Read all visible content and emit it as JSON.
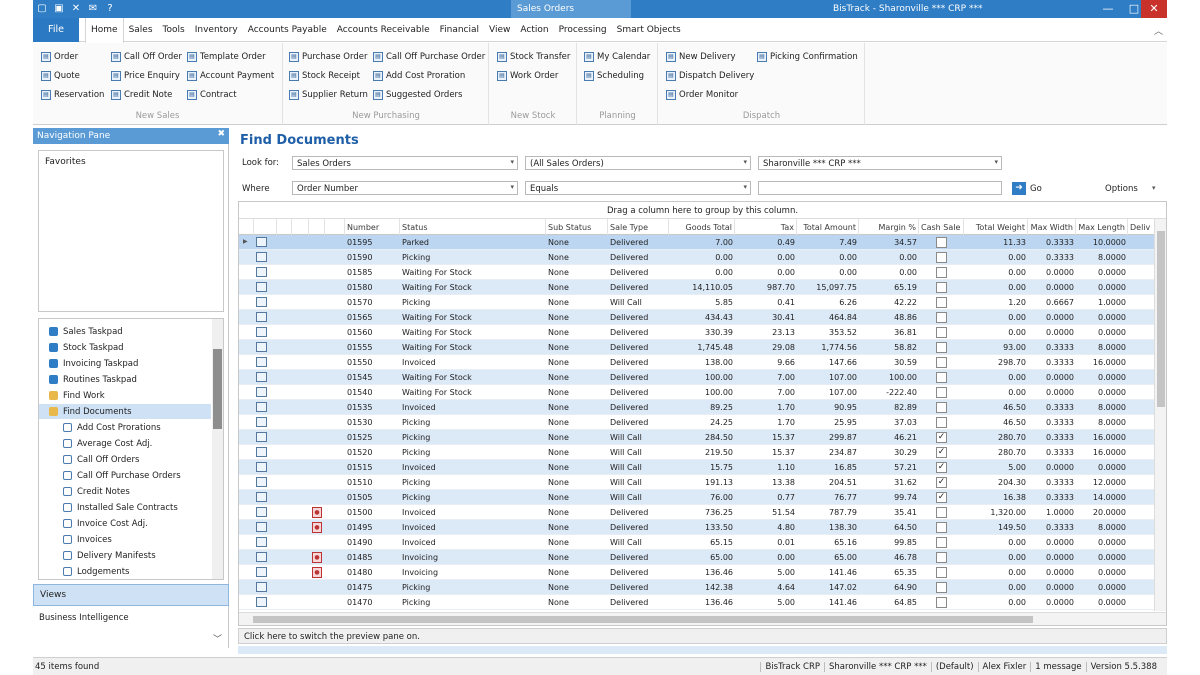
{
  "titlebar": {
    "context_tab": "Sales Orders",
    "app_title": "BisTrack - Sharonville *** CRP ***",
    "min": "—",
    "max": "□",
    "close": "✕"
  },
  "menu": {
    "file": "File",
    "tabs": [
      "Home",
      "Sales",
      "Tools",
      "Inventory",
      "Accounts Payable",
      "Accounts Receivable",
      "Financial",
      "View",
      "Action",
      "Processing",
      "Smart Objects"
    ]
  },
  "ribbon": {
    "new_sales": {
      "label": "New Sales",
      "buttons": [
        "Order",
        "Call Off Order",
        "Template Order",
        "Quote",
        "Price Enquiry",
        "Account Payment",
        "Reservation",
        "Credit Note",
        "Contract"
      ]
    },
    "new_purchasing": {
      "label": "New Purchasing",
      "buttons": [
        "Purchase Order",
        "Call Off Purchase Order",
        "Stock Receipt",
        "Add Cost Proration",
        "Supplier Return",
        "Suggested Orders"
      ]
    },
    "new_stock": {
      "label": "New Stock",
      "buttons": [
        "Stock Transfer",
        "Work Order"
      ]
    },
    "planning": {
      "label": "Planning",
      "buttons": [
        "My Calendar",
        "Scheduling"
      ]
    },
    "dispatch": {
      "label": "Dispatch",
      "buttons": [
        "New Delivery",
        "Picking Confirmation",
        "Dispatch Delivery",
        "Order Monitor"
      ]
    }
  },
  "nav": {
    "header": "Navigation Pane",
    "pin": "✖",
    "favorites": "Favorites",
    "tree": [
      "Sales Taskpad",
      "Stock Taskpad",
      "Invoicing Taskpad",
      "Routines Taskpad",
      "Find Work",
      "Find Documents",
      "Add Cost Prorations",
      "Average Cost Adj.",
      "Call Off Orders",
      "Call Off Purchase Orders",
      "Credit Notes",
      "Installed Sale Contracts",
      "Invoice Cost Adj.",
      "Invoices",
      "Delivery Manifests",
      "Lodgements"
    ],
    "views": "Views",
    "business_intelligence": "Business Intelligence"
  },
  "find": {
    "title": "Find Documents",
    "look_for_label": "Look for:",
    "look_for_value": "Sales Orders",
    "scope_value": "(All Sales Orders)",
    "branch_value": "Sharonville *** CRP ***",
    "where_label": "Where",
    "where_field": "Order Number",
    "operator": "Equals",
    "search_value": "",
    "go": "Go",
    "options": "Options"
  },
  "grid": {
    "group_hint": "Drag a column here to group by this column.",
    "columns": [
      "Number",
      "Status",
      "Sub Status",
      "Sale Type",
      "Goods Total",
      "Tax",
      "Total Amount",
      "Margin %",
      "Cash Sale",
      "Total Weight",
      "Max Width",
      "Max Length",
      "Deliv"
    ],
    "rows": [
      {
        "number": "01595",
        "status": "Parked",
        "sub": "None",
        "type": "Delivered",
        "goods": "7.00",
        "tax": "0.49",
        "total": "7.49",
        "margin": "34.57",
        "cash": false,
        "weight": "11.33",
        "width": "0.3333",
        "length": "10.0000",
        "flag": false
      },
      {
        "number": "01590",
        "status": "Picking",
        "sub": "None",
        "type": "Delivered",
        "goods": "0.00",
        "tax": "0.00",
        "total": "0.00",
        "margin": "0.00",
        "cash": false,
        "weight": "0.00",
        "width": "0.3333",
        "length": "8.0000",
        "flag": false
      },
      {
        "number": "01585",
        "status": "Waiting For Stock",
        "sub": "None",
        "type": "Delivered",
        "goods": "0.00",
        "tax": "0.00",
        "total": "0.00",
        "margin": "0.00",
        "cash": false,
        "weight": "0.00",
        "width": "0.0000",
        "length": "0.0000",
        "flag": false
      },
      {
        "number": "01580",
        "status": "Waiting For Stock",
        "sub": "None",
        "type": "Delivered",
        "goods": "14,110.05",
        "tax": "987.70",
        "total": "15,097.75",
        "margin": "65.19",
        "cash": false,
        "weight": "0.00",
        "width": "0.0000",
        "length": "0.0000",
        "flag": false
      },
      {
        "number": "01570",
        "status": "Picking",
        "sub": "None",
        "type": "Will Call",
        "goods": "5.85",
        "tax": "0.41",
        "total": "6.26",
        "margin": "42.22",
        "cash": false,
        "weight": "1.20",
        "width": "0.6667",
        "length": "1.0000",
        "flag": false
      },
      {
        "number": "01565",
        "status": "Waiting For Stock",
        "sub": "None",
        "type": "Delivered",
        "goods": "434.43",
        "tax": "30.41",
        "total": "464.84",
        "margin": "48.86",
        "cash": false,
        "weight": "0.00",
        "width": "0.0000",
        "length": "0.0000",
        "flag": false
      },
      {
        "number": "01560",
        "status": "Waiting For Stock",
        "sub": "None",
        "type": "Delivered",
        "goods": "330.39",
        "tax": "23.13",
        "total": "353.52",
        "margin": "36.81",
        "cash": false,
        "weight": "0.00",
        "width": "0.0000",
        "length": "0.0000",
        "flag": false
      },
      {
        "number": "01555",
        "status": "Waiting For Stock",
        "sub": "None",
        "type": "Delivered",
        "goods": "1,745.48",
        "tax": "29.08",
        "total": "1,774.56",
        "margin": "58.82",
        "cash": false,
        "weight": "93.00",
        "width": "0.3333",
        "length": "8.0000",
        "flag": false
      },
      {
        "number": "01550",
        "status": "Invoiced",
        "sub": "None",
        "type": "Delivered",
        "goods": "138.00",
        "tax": "9.66",
        "total": "147.66",
        "margin": "30.59",
        "cash": false,
        "weight": "298.70",
        "width": "0.3333",
        "length": "16.0000",
        "flag": false
      },
      {
        "number": "01545",
        "status": "Waiting For Stock",
        "sub": "None",
        "type": "Delivered",
        "goods": "100.00",
        "tax": "7.00",
        "total": "107.00",
        "margin": "100.00",
        "cash": false,
        "weight": "0.00",
        "width": "0.0000",
        "length": "0.0000",
        "flag": false
      },
      {
        "number": "01540",
        "status": "Waiting For Stock",
        "sub": "None",
        "type": "Delivered",
        "goods": "100.00",
        "tax": "7.00",
        "total": "107.00",
        "margin": "-222.40",
        "cash": false,
        "weight": "0.00",
        "width": "0.0000",
        "length": "0.0000",
        "flag": false
      },
      {
        "number": "01535",
        "status": "Invoiced",
        "sub": "None",
        "type": "Delivered",
        "goods": "89.25",
        "tax": "1.70",
        "total": "90.95",
        "margin": "82.89",
        "cash": false,
        "weight": "46.50",
        "width": "0.3333",
        "length": "8.0000",
        "flag": false
      },
      {
        "number": "01530",
        "status": "Picking",
        "sub": "None",
        "type": "Delivered",
        "goods": "24.25",
        "tax": "1.70",
        "total": "25.95",
        "margin": "37.03",
        "cash": false,
        "weight": "46.50",
        "width": "0.3333",
        "length": "8.0000",
        "flag": false
      },
      {
        "number": "01525",
        "status": "Picking",
        "sub": "None",
        "type": "Will Call",
        "goods": "284.50",
        "tax": "15.37",
        "total": "299.87",
        "margin": "46.21",
        "cash": true,
        "weight": "280.70",
        "width": "0.3333",
        "length": "16.0000",
        "flag": false
      },
      {
        "number": "01520",
        "status": "Picking",
        "sub": "None",
        "type": "Will Call",
        "goods": "219.50",
        "tax": "15.37",
        "total": "234.87",
        "margin": "30.29",
        "cash": true,
        "weight": "280.70",
        "width": "0.3333",
        "length": "16.0000",
        "flag": false
      },
      {
        "number": "01515",
        "status": "Invoiced",
        "sub": "None",
        "type": "Will Call",
        "goods": "15.75",
        "tax": "1.10",
        "total": "16.85",
        "margin": "57.21",
        "cash": true,
        "weight": "5.00",
        "width": "0.0000",
        "length": "0.0000",
        "flag": false
      },
      {
        "number": "01510",
        "status": "Picking",
        "sub": "None",
        "type": "Will Call",
        "goods": "191.13",
        "tax": "13.38",
        "total": "204.51",
        "margin": "31.62",
        "cash": true,
        "weight": "204.30",
        "width": "0.3333",
        "length": "12.0000",
        "flag": false
      },
      {
        "number": "01505",
        "status": "Picking",
        "sub": "None",
        "type": "Will Call",
        "goods": "76.00",
        "tax": "0.77",
        "total": "76.77",
        "margin": "99.74",
        "cash": true,
        "weight": "16.38",
        "width": "0.3333",
        "length": "14.0000",
        "flag": false
      },
      {
        "number": "01500",
        "status": "Invoiced",
        "sub": "None",
        "type": "Delivered",
        "goods": "736.25",
        "tax": "51.54",
        "total": "787.79",
        "margin": "35.41",
        "cash": false,
        "weight": "1,320.00",
        "width": "1.0000",
        "length": "20.0000",
        "flag": true
      },
      {
        "number": "01495",
        "status": "Invoiced",
        "sub": "None",
        "type": "Delivered",
        "goods": "133.50",
        "tax": "4.80",
        "total": "138.30",
        "margin": "64.50",
        "cash": false,
        "weight": "149.50",
        "width": "0.3333",
        "length": "8.0000",
        "flag": true
      },
      {
        "number": "01490",
        "status": "Invoiced",
        "sub": "None",
        "type": "Will Call",
        "goods": "65.15",
        "tax": "0.01",
        "total": "65.16",
        "margin": "99.85",
        "cash": false,
        "weight": "0.00",
        "width": "0.0000",
        "length": "0.0000",
        "flag": false
      },
      {
        "number": "01485",
        "status": "Invoicing",
        "sub": "None",
        "type": "Delivered",
        "goods": "65.00",
        "tax": "0.00",
        "total": "65.00",
        "margin": "46.78",
        "cash": false,
        "weight": "0.00",
        "width": "0.0000",
        "length": "0.0000",
        "flag": true
      },
      {
        "number": "01480",
        "status": "Invoicing",
        "sub": "None",
        "type": "Delivered",
        "goods": "136.46",
        "tax": "5.00",
        "total": "141.46",
        "margin": "65.35",
        "cash": false,
        "weight": "0.00",
        "width": "0.0000",
        "length": "0.0000",
        "flag": true
      },
      {
        "number": "01475",
        "status": "Picking",
        "sub": "None",
        "type": "Delivered",
        "goods": "142.38",
        "tax": "4.64",
        "total": "147.02",
        "margin": "64.90",
        "cash": false,
        "weight": "0.00",
        "width": "0.0000",
        "length": "0.0000",
        "flag": false
      },
      {
        "number": "01470",
        "status": "Picking",
        "sub": "None",
        "type": "Delivered",
        "goods": "136.46",
        "tax": "5.00",
        "total": "141.46",
        "margin": "64.85",
        "cash": false,
        "weight": "0.00",
        "width": "0.0000",
        "length": "0.0000",
        "flag": false
      }
    ],
    "preview_hint": "Click here to switch the preview pane on."
  },
  "status": {
    "items_found": "45 items found",
    "right": [
      "BisTrack CRP",
      "Sharonville *** CRP ***",
      "(Default)",
      "Alex Fixler",
      "1 message",
      "Version 5.5.388"
    ]
  }
}
